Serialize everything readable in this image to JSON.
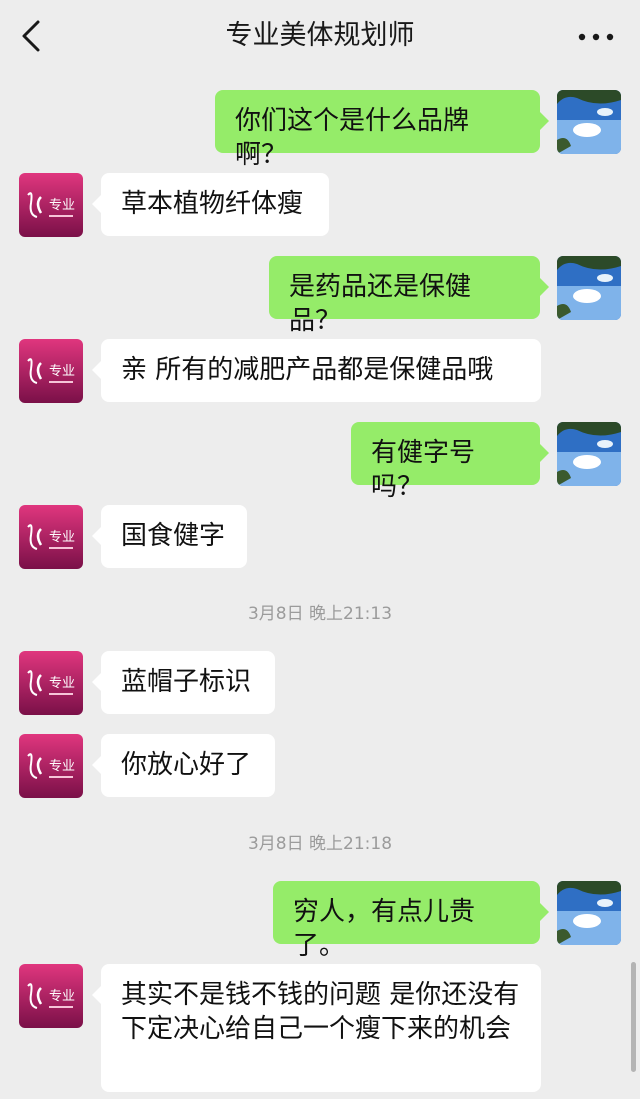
{
  "header": {
    "title": "专业美体规划师",
    "back_icon": "chevron-left-icon",
    "more_icon": "more-dots-icon"
  },
  "messages": [
    {
      "side": "out",
      "text": "你们这个是什么品牌啊？"
    },
    {
      "side": "in",
      "text": "草本植物纤体瘦"
    },
    {
      "side": "out",
      "text": "是药品还是保健品？"
    },
    {
      "side": "in",
      "text": "亲 所有的减肥产品都是保健品哦"
    },
    {
      "side": "out",
      "text": "有健字号吗？"
    },
    {
      "side": "in",
      "text": "国食健字"
    },
    {
      "side": "in",
      "text": "蓝帽子标识"
    },
    {
      "side": "in",
      "text": "你放心好了"
    },
    {
      "side": "out",
      "text": "穷人，有点儿贵了。"
    },
    {
      "side": "in",
      "text": "其实不是钱不钱的问题 是你还没有下定决心给自己一个瘦下来的机会"
    }
  ],
  "timestamps": [
    "3月8日 晚上21:13",
    "3月8日 晚上21:18"
  ],
  "avatars": {
    "contact_logo_text": "专业",
    "contact_colors": [
      "#e0367e",
      "#7a1048"
    ],
    "self_sky_colors": [
      "#2f6fc4",
      "#7fb3ea"
    ]
  },
  "colors": {
    "background": "#ededed",
    "outgoing_bubble": "#95ec69",
    "incoming_bubble": "#ffffff"
  }
}
